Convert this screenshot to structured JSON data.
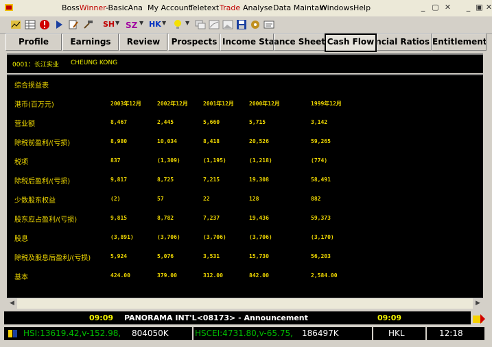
{
  "app": {
    "name_prefix": "Boss",
    "name_brand": "Winner",
    "name_suffix": "-BasicAna"
  },
  "menu": {
    "my_account": "My Account",
    "teletext": "Teletext",
    "trade": "Trade",
    "analyse": "Analyse",
    "data_maintain": "Data Maintain",
    "windows": "Windows",
    "help": "Help"
  },
  "toolbar": {
    "sh": "SH",
    "hk": "HK"
  },
  "tabs": [
    "Profile",
    "Earnings",
    "Review",
    "Prospects",
    "Income Statement",
    "Balance Sheet",
    "Cash Flow",
    "Financial Ratios",
    "Entitlement"
  ],
  "stock": {
    "code": "0001：长江实业",
    "name_en": "CHEUNG KONG"
  },
  "table": {
    "section_title": "综合损益表",
    "currency_label": "港币(百万元)",
    "columns": [
      "2003年12月",
      "2002年12月",
      "2001年12月",
      "2000年12月",
      "1999年12月"
    ],
    "rows": [
      {
        "label": "营业额",
        "values": [
          "8,467",
          "2,445",
          "5,660",
          "5,715",
          "3,142"
        ]
      },
      {
        "label": "除税前盈利/(亏损)",
        "values": [
          "8,980",
          "10,034",
          "8,418",
          "20,526",
          "59,265"
        ]
      },
      {
        "label": "税项",
        "values": [
          "837",
          "(1,309)",
          "(1,195)",
          "(1,218)",
          "(774)"
        ]
      },
      {
        "label": "除税后盈利/(亏损)",
        "values": [
          "9,817",
          "8,725",
          "7,215",
          "19,308",
          "58,491"
        ]
      },
      {
        "label": "少数股东权益",
        "values": [
          "(2)",
          "57",
          "22",
          "128",
          "882"
        ]
      },
      {
        "label": "股东应占盈利/(亏损)",
        "values": [
          "9,815",
          "8,782",
          "7,237",
          "19,436",
          "59,373"
        ]
      },
      {
        "label": "股息",
        "values": [
          "(3,891)",
          "(3,706)",
          "(3,706)",
          "(3,706)",
          "(3,170)"
        ]
      },
      {
        "label": "除税及股息后盈利/(亏损)",
        "values": [
          "5,924",
          "5,076",
          "3,531",
          "15,730",
          "56,203"
        ]
      },
      {
        "label": "基本",
        "values": [
          "424.00",
          "379.00",
          "312.00",
          "842.00",
          "2,584.00"
        ]
      }
    ]
  },
  "news": {
    "time_left": "09:09",
    "text": "PANORAMA INT'L<08173> - Announcement",
    "time_right": "09:09"
  },
  "status": {
    "hsi": "HSI:13619.42,v-152.98,",
    "hsi_vol": "804050K",
    "hscei": "HSCEI:4731.80,v-65.75,",
    "hscei_vol": "186497K",
    "market": "HKL",
    "time": "12:18"
  }
}
